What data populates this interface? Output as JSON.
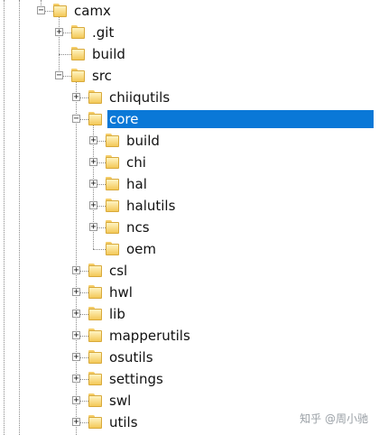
{
  "tree": [
    {
      "label": "camx",
      "depth": 1,
      "toggle": "-",
      "has_toggle": true,
      "selected": false
    },
    {
      "label": ".git",
      "depth": 2,
      "toggle": "+",
      "has_toggle": true,
      "selected": false
    },
    {
      "label": "build",
      "depth": 2,
      "toggle": "",
      "has_toggle": false,
      "selected": false
    },
    {
      "label": "src",
      "depth": 2,
      "toggle": "-",
      "has_toggle": true,
      "selected": false
    },
    {
      "label": "chiiqutils",
      "depth": 3,
      "toggle": "+",
      "has_toggle": true,
      "selected": false
    },
    {
      "label": "core",
      "depth": 3,
      "toggle": "-",
      "has_toggle": true,
      "selected": true
    },
    {
      "label": "build",
      "depth": 4,
      "toggle": "+",
      "has_toggle": true,
      "selected": false
    },
    {
      "label": "chi",
      "depth": 4,
      "toggle": "+",
      "has_toggle": true,
      "selected": false
    },
    {
      "label": "hal",
      "depth": 4,
      "toggle": "+",
      "has_toggle": true,
      "selected": false
    },
    {
      "label": "halutils",
      "depth": 4,
      "toggle": "+",
      "has_toggle": true,
      "selected": false
    },
    {
      "label": "ncs",
      "depth": 4,
      "toggle": "+",
      "has_toggle": true,
      "selected": false
    },
    {
      "label": "oem",
      "depth": 4,
      "toggle": "",
      "has_toggle": false,
      "selected": false
    },
    {
      "label": "csl",
      "depth": 3,
      "toggle": "+",
      "has_toggle": true,
      "selected": false
    },
    {
      "label": "hwl",
      "depth": 3,
      "toggle": "+",
      "has_toggle": true,
      "selected": false
    },
    {
      "label": "lib",
      "depth": 3,
      "toggle": "+",
      "has_toggle": true,
      "selected": false
    },
    {
      "label": "mapperutils",
      "depth": 3,
      "toggle": "+",
      "has_toggle": true,
      "selected": false
    },
    {
      "label": "osutils",
      "depth": 3,
      "toggle": "+",
      "has_toggle": true,
      "selected": false
    },
    {
      "label": "settings",
      "depth": 3,
      "toggle": "+",
      "has_toggle": true,
      "selected": false
    },
    {
      "label": "swl",
      "depth": 3,
      "toggle": "+",
      "has_toggle": true,
      "selected": false
    },
    {
      "label": "utils",
      "depth": 3,
      "toggle": "+",
      "has_toggle": true,
      "selected": false
    }
  ],
  "watermark": "知乎 @周小驰",
  "colors": {
    "selection": "#0a78d7",
    "folder": "#f3c857",
    "connector": "#8a8a8a"
  },
  "icons": {
    "folder": "folder-icon",
    "expand": "expand-icon",
    "collapse": "collapse-icon"
  }
}
